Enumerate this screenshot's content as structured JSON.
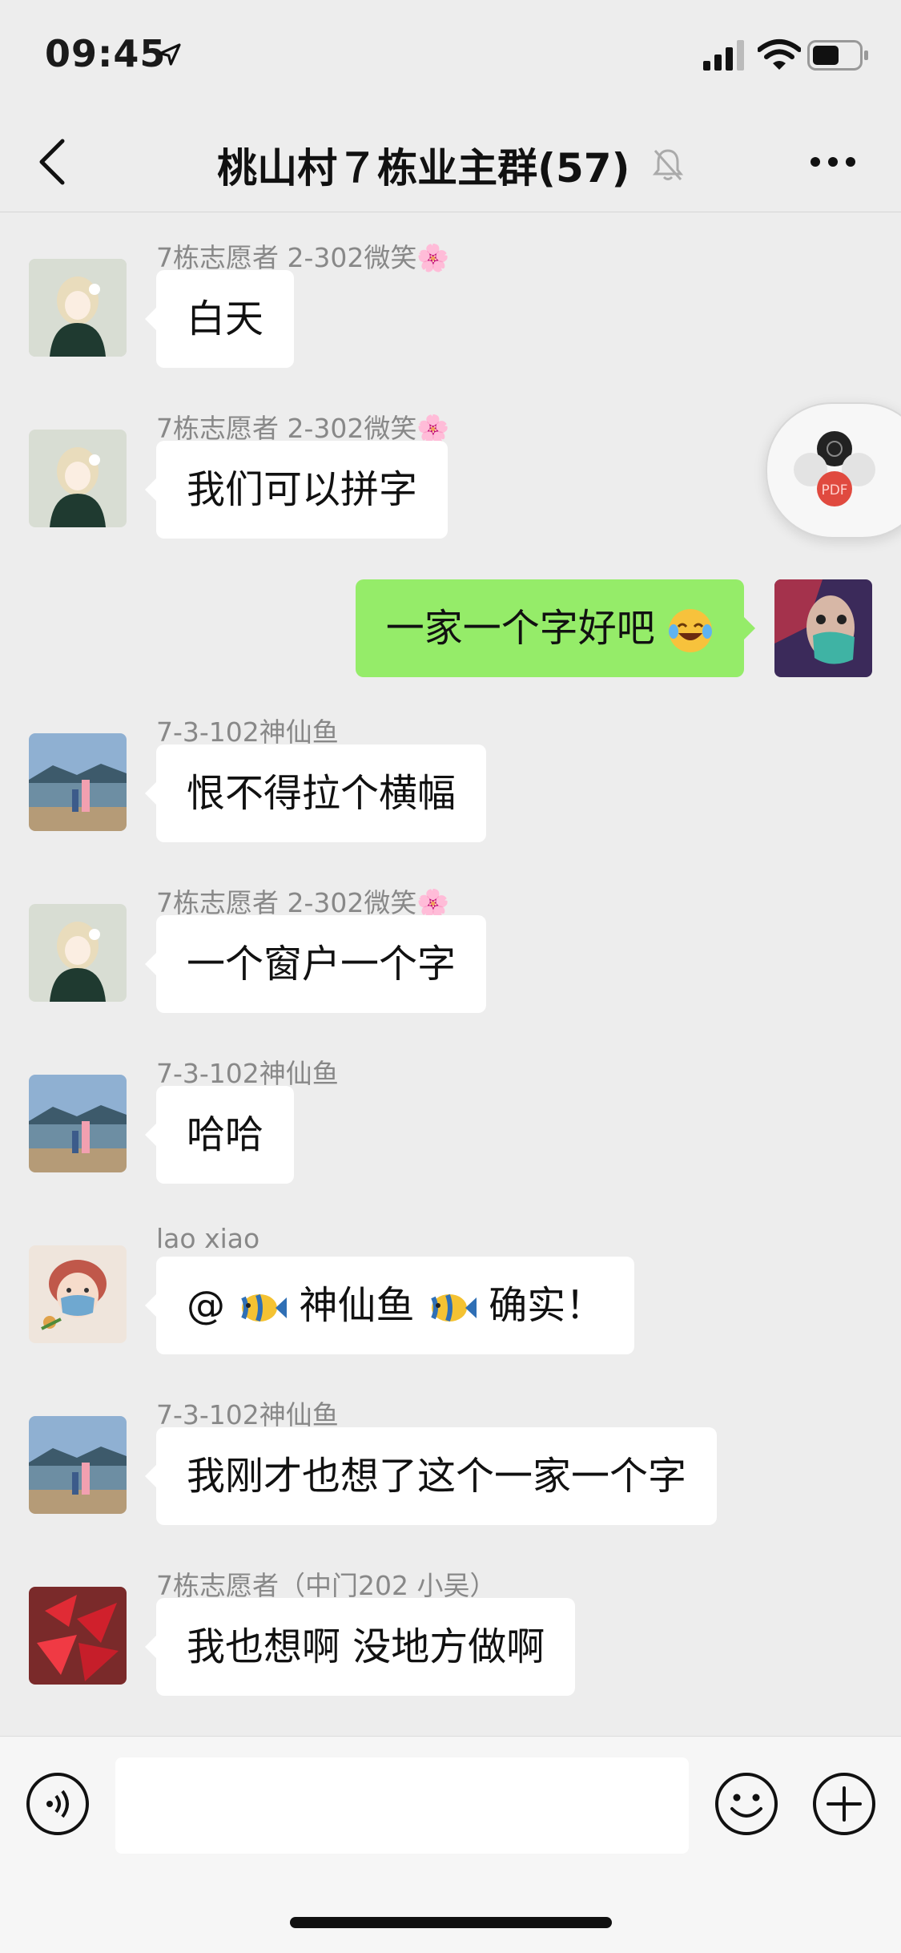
{
  "status_bar": {
    "time": "09:45"
  },
  "header": {
    "title": "桃山村７栋业主群(57)"
  },
  "messages": [
    {
      "sender": "7栋志愿者 2-302微笑🌸",
      "text": "白天",
      "side": "left"
    },
    {
      "sender": "7栋志愿者 2-302微笑🌸",
      "text": "我们可以拼字",
      "side": "left"
    },
    {
      "sender": "",
      "text": "一家一个字好吧",
      "side": "right"
    },
    {
      "sender": "7-3-102神仙鱼",
      "text": "恨不得拉个横幅",
      "side": "left"
    },
    {
      "sender": "7栋志愿者 2-302微笑🌸",
      "text": "一个窗户一个字",
      "side": "left"
    },
    {
      "sender": "7-3-102神仙鱼",
      "text": "哈哈",
      "side": "left"
    },
    {
      "sender": "lao  xiao",
      "text_prefix": "@",
      "text_name": " 神仙鱼",
      "text_suffix": " 确实！",
      "side": "left"
    },
    {
      "sender": "7-3-102神仙鱼",
      "text": "我刚才也想了这个一家一个字",
      "side": "left"
    },
    {
      "sender": "7栋志愿者（中门202 小吴）",
      "text": "我也想啊  没地方做啊",
      "side": "left"
    }
  ],
  "floating_widget": {
    "label": "PDF"
  },
  "colors": {
    "my_bubble": "#95ec69",
    "their_bubble": "#ffffff",
    "background": "#ededed"
  },
  "icons": [
    "back-arrow-icon",
    "mute-bell-icon",
    "more-dots-icon",
    "voice-icon",
    "emoji-icon",
    "plus-icon"
  ]
}
